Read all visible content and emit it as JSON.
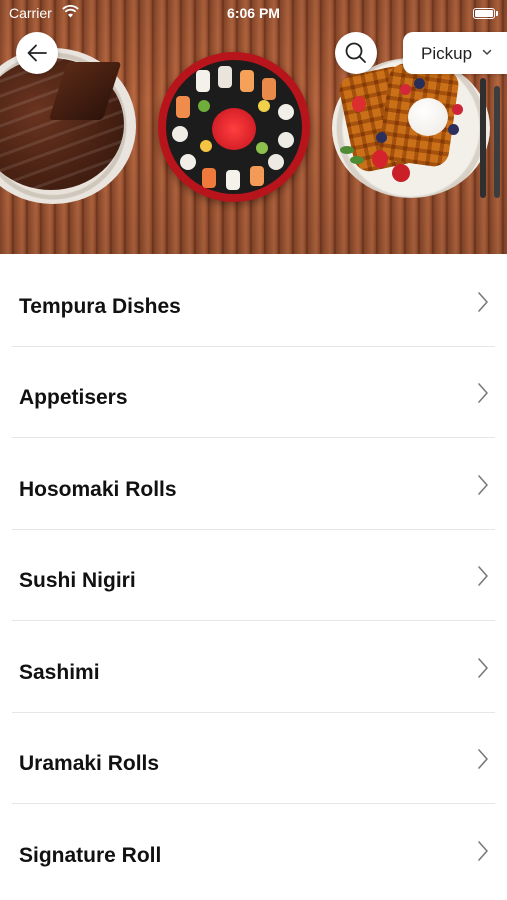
{
  "status_bar": {
    "carrier": "Carrier",
    "time": "6:06 PM"
  },
  "header": {
    "icons": {
      "back": "arrow-left-icon",
      "search": "search-icon",
      "dropdown": "chevron-down-icon"
    },
    "pickup_label": "Pickup"
  },
  "categories": [
    {
      "label": "Tempura Dishes"
    },
    {
      "label": "Appetisers"
    },
    {
      "label": "Hosomaki Rolls"
    },
    {
      "label": "Sushi Nigiri"
    },
    {
      "label": "Sashimi"
    },
    {
      "label": "Uramaki Rolls"
    },
    {
      "label": "Signature Roll"
    }
  ],
  "colors": {
    "accent_red": "#b8141b",
    "text": "#111111",
    "divider": "#e6e6e6"
  }
}
